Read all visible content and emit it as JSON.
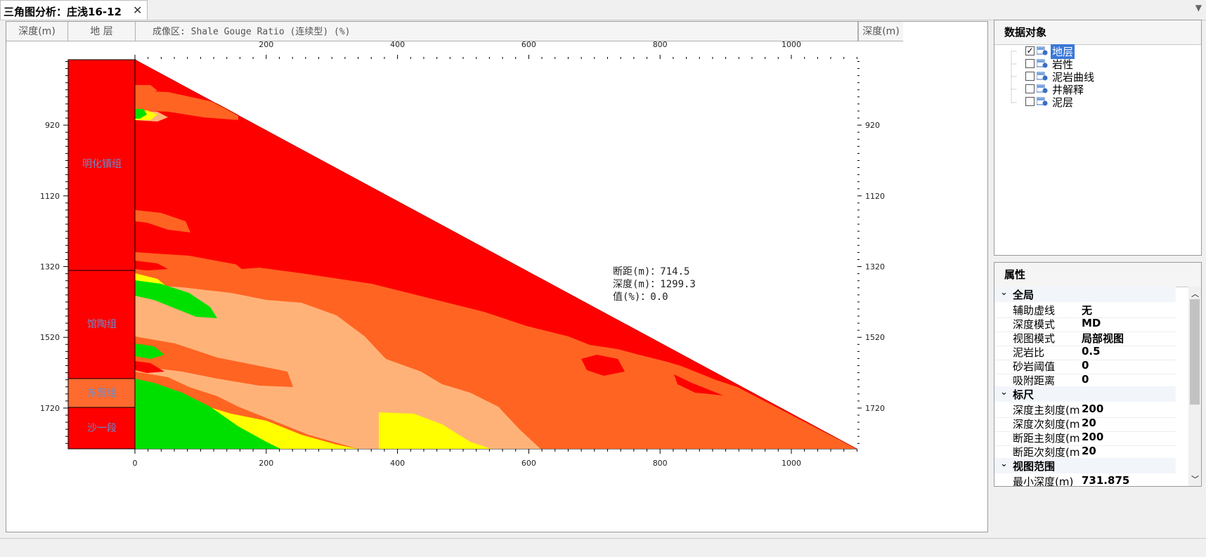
{
  "tab": {
    "title": "三角图分析：庄浅16-12",
    "close": "✕"
  },
  "header": {
    "depth_left": "深度(m)",
    "strata": "地  层",
    "imaging": "成像区: Shale Gouge Ratio (连续型) (%)",
    "depth_right": "深度(m)"
  },
  "axes": {
    "x_ticks": [
      "200",
      "400",
      "600",
      "800",
      "1000"
    ],
    "x_bottom_ticks": [
      "0",
      "200",
      "400",
      "600",
      "800",
      "1000"
    ],
    "depth_ticks": [
      "920",
      "1120",
      "1320",
      "1520",
      "1720"
    ]
  },
  "strata": [
    {
      "name": "明化镇组",
      "color": "#ff0000"
    },
    {
      "name": "馆陶组",
      "color": "#ff0000"
    },
    {
      "name": "东营组",
      "color": "#ff6a2e"
    },
    {
      "name": "沙一段",
      "color": "#ff0000"
    }
  ],
  "readout": {
    "line1": "断距(m)：714.5",
    "line2": "深度(m)：1299.3",
    "line3": "值(%)：0.0"
  },
  "colors": {
    "red": "#ff0000",
    "orange": "#ff6422",
    "peach": "#ffb278",
    "yellow": "#ffff00",
    "green": "#00e000"
  },
  "data_objects": {
    "title": "数据对象",
    "items": [
      {
        "label": "地层",
        "checked": true,
        "selected": true
      },
      {
        "label": "岩性",
        "checked": false,
        "selected": false
      },
      {
        "label": "泥岩曲线",
        "checked": false,
        "selected": false
      },
      {
        "label": "井解释",
        "checked": false,
        "selected": false
      },
      {
        "label": "泥层",
        "checked": false,
        "selected": false
      }
    ]
  },
  "properties": {
    "title": "属性",
    "sections": [
      {
        "name": "全局",
        "rows": [
          {
            "k": "辅助虚线",
            "v": "无"
          },
          {
            "k": "深度模式",
            "v": "MD"
          },
          {
            "k": "视图模式",
            "v": "局部视图"
          },
          {
            "k": "泥岩比",
            "v": "0.5"
          },
          {
            "k": "砂岩阈值",
            "v": "0"
          },
          {
            "k": "吸附距离",
            "v": "0"
          }
        ]
      },
      {
        "name": "标尺",
        "rows": [
          {
            "k": "深度主刻度(m)",
            "v": "200"
          },
          {
            "k": "深度次刻度(m)",
            "v": "20"
          },
          {
            "k": "断距主刻度(m)",
            "v": "200"
          },
          {
            "k": "断距次刻度(m)",
            "v": "20"
          }
        ]
      },
      {
        "name": "视图范围",
        "rows": [
          {
            "k": "最小深度(m)",
            "v": "731.875"
          }
        ]
      }
    ]
  }
}
